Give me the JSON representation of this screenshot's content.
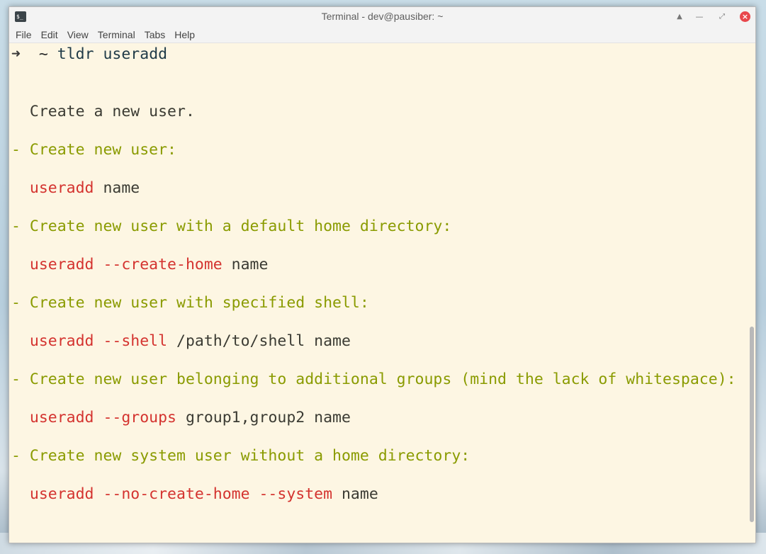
{
  "window": {
    "title": "Terminal - dev@pausiber: ~",
    "icon_glyph": "$_"
  },
  "menu": [
    "File",
    "Edit",
    "View",
    "Terminal",
    "Tabs",
    "Help"
  ],
  "terminal": {
    "prompt": {
      "arrow": "➜",
      "dir": "~",
      "command": "tldr useradd"
    },
    "description": "Create a new user.",
    "entries": [
      {
        "heading": "- Create new user:",
        "cmd": "useradd",
        "arg1": " name",
        "flag2": "",
        "arg2": ""
      },
      {
        "heading": "- Create new user with a default home directory:",
        "cmd": "useradd --create-home",
        "arg1": " name",
        "flag2": "",
        "arg2": ""
      },
      {
        "heading": "- Create new user with specified shell:",
        "cmd": "useradd --shell",
        "arg1": " /path/to/shell name",
        "flag2": "",
        "arg2": ""
      },
      {
        "heading": "- Create new user belonging to additional groups (mind the lack of whitespace):",
        "cmd": "useradd --groups",
        "arg1": " group1,group2 name",
        "flag2": "",
        "arg2": ""
      },
      {
        "heading": "- Create new system user without a home directory:",
        "cmd": "useradd --no-create-home --system",
        "arg1": " name",
        "flag2": "",
        "arg2": ""
      }
    ]
  },
  "colors": {
    "background": "#fdf6e3",
    "heading": "#8a9b00",
    "command": "#d4332f",
    "text": "#3b3b33"
  }
}
